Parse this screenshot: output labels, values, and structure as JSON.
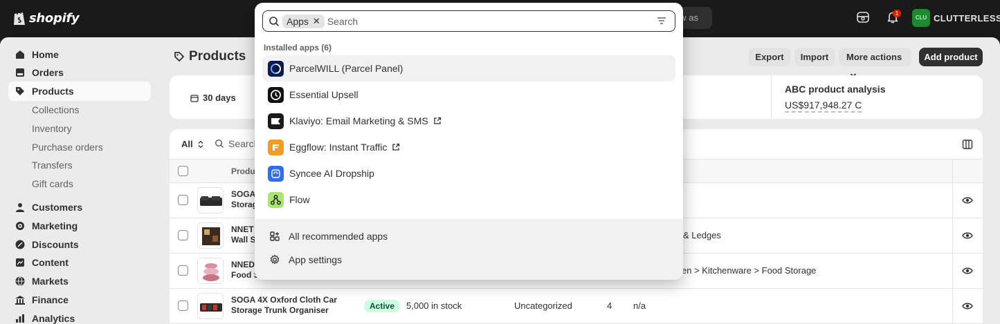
{
  "topbar": {
    "logo_text": "shopify",
    "view_as": "ew as",
    "notification_count": "1",
    "store_initials": "CLU",
    "store_name": "CLUTTERLESS"
  },
  "sidebar": {
    "items": [
      {
        "label": "Home",
        "icon": "home-icon"
      },
      {
        "label": "Orders",
        "icon": "orders-icon"
      },
      {
        "label": "Products",
        "icon": "tag-icon",
        "active": true
      },
      {
        "label": "Customers",
        "icon": "person-icon"
      },
      {
        "label": "Marketing",
        "icon": "target-icon"
      },
      {
        "label": "Discounts",
        "icon": "discount-icon"
      },
      {
        "label": "Content",
        "icon": "content-icon"
      },
      {
        "label": "Markets",
        "icon": "globe-icon"
      },
      {
        "label": "Finance",
        "icon": "bank-icon"
      },
      {
        "label": "Analytics",
        "icon": "chart-icon"
      }
    ],
    "sub_items": [
      "Collections",
      "Inventory",
      "Purchase orders",
      "Transfers",
      "Gift cards"
    ]
  },
  "main": {
    "title": "Products",
    "buttons": {
      "export": "Export",
      "import": "Import",
      "more_actions": "More actions",
      "add_product": "Add product"
    },
    "analytics": {
      "period": "30 days",
      "abc_title": "ABC product analysis",
      "abc_value": "US$917,948.27",
      "abc_suffix": "C"
    },
    "table": {
      "filter_all": "All",
      "search_placeholder": "Search",
      "product_header": "Produ",
      "rows": [
        {
          "name": "SOGA",
          "name2": "Storag",
          "status": "",
          "inventory": "",
          "category": "",
          "count": "",
          "type": ""
        },
        {
          "name": "NNET",
          "name2": "Wall S",
          "status": "",
          "inventory": "",
          "category": "",
          "count": "",
          "type": "& Ledges"
        },
        {
          "name": "NNED",
          "name2": "Food S",
          "status": "",
          "inventory": "",
          "category": "",
          "count": "",
          "type": "en > Kitchenware > Food Storage"
        },
        {
          "name": "SOGA 4X Oxford Cloth Car",
          "name2": "Storage Trunk Organiser",
          "status": "Active",
          "inventory": "5,000 in stock",
          "category": "Uncategorized",
          "count": "4",
          "type": "n/a"
        }
      ]
    }
  },
  "palette": {
    "chip_label": "Apps",
    "search_placeholder": "Search",
    "section_label": "Installed apps (6)",
    "apps": [
      {
        "label": "ParcelWILL (Parcel Panel)",
        "icon": "parcelwill-icon",
        "color": "#0b1b4d",
        "external": false,
        "highlighted": true
      },
      {
        "label": "Essential Upsell",
        "icon": "essential-upsell-icon",
        "color": "#111111",
        "external": false,
        "highlighted": false
      },
      {
        "label": "Klaviyo: Email Marketing & SMS",
        "icon": "klaviyo-icon",
        "color": "#1a1a1a",
        "external": true,
        "highlighted": false
      },
      {
        "label": "Eggflow: Instant Traffic",
        "icon": "eggflow-icon",
        "color": "#f59a23",
        "external": true,
        "highlighted": false
      },
      {
        "label": "Syncee AI Dropship",
        "icon": "syncee-icon",
        "color": "#2f6df6",
        "external": false,
        "highlighted": false
      },
      {
        "label": "Flow",
        "icon": "flow-icon",
        "color": "#a9e56f",
        "external": false,
        "highlighted": false
      }
    ],
    "footer": {
      "recommended": "All recommended apps",
      "settings": "App settings"
    }
  }
}
